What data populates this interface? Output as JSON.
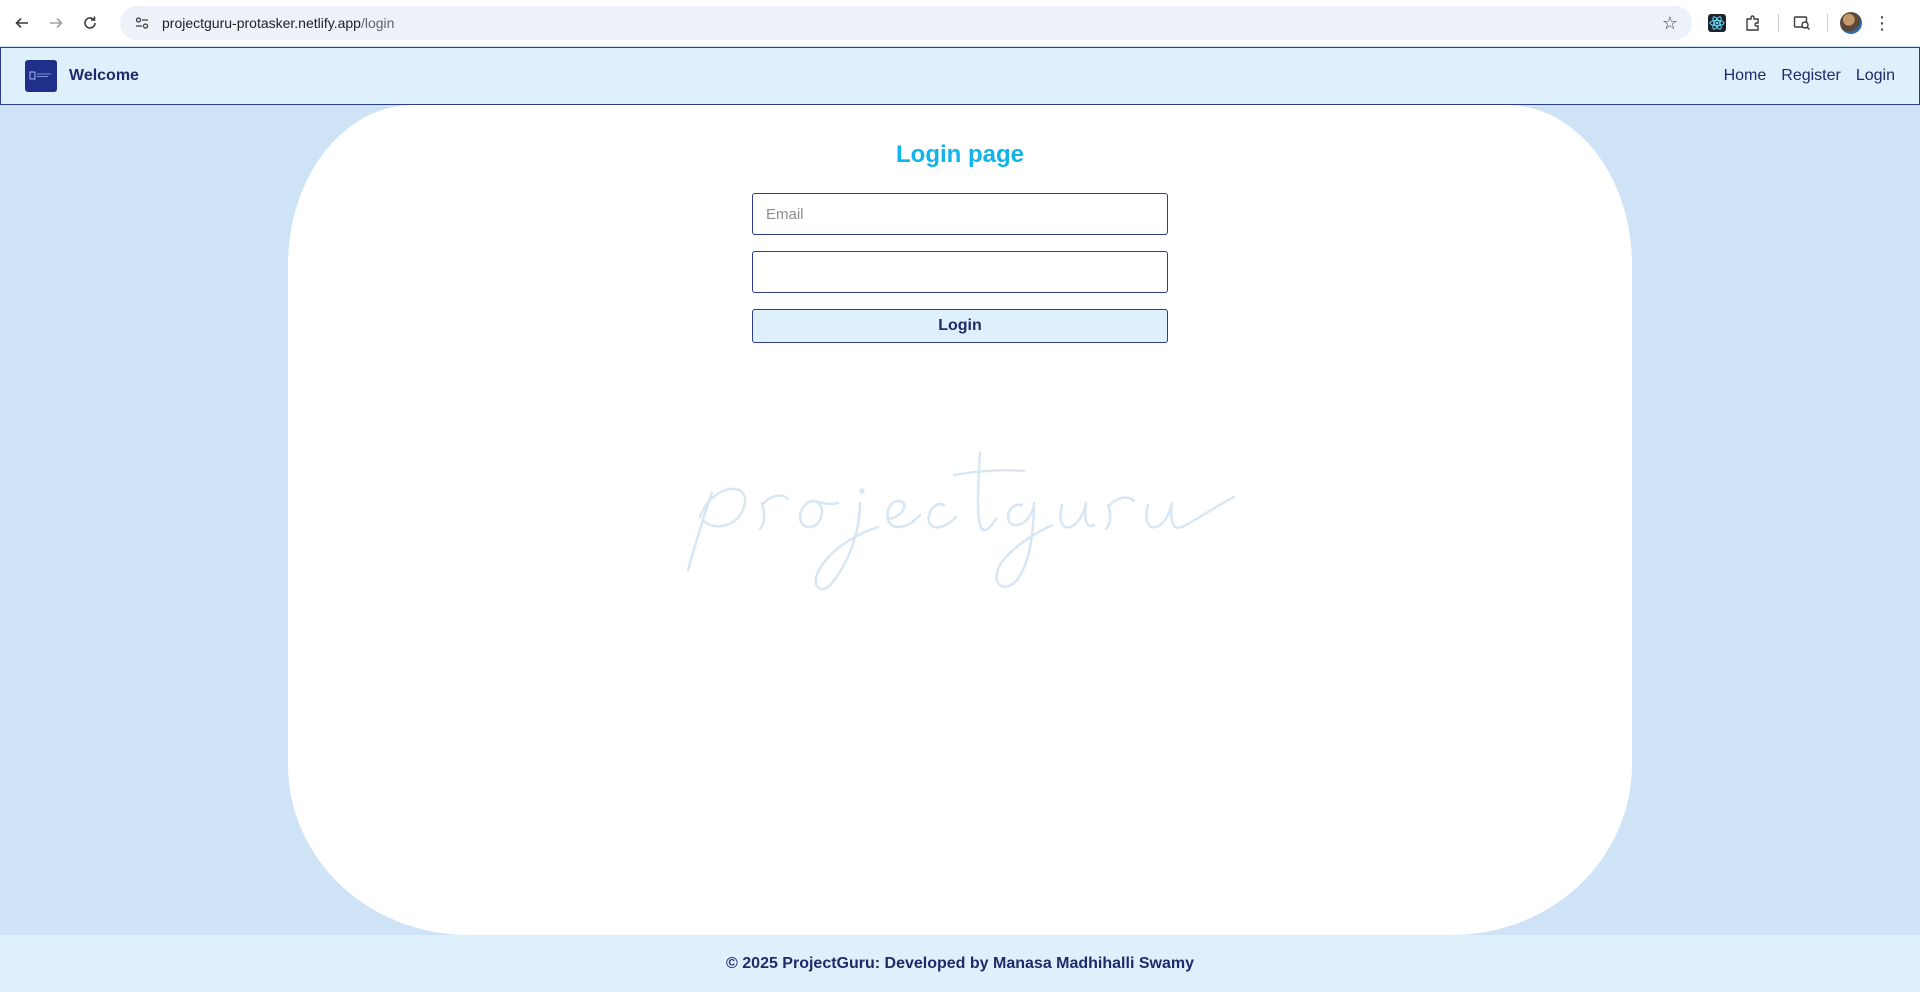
{
  "browser": {
    "url_host": "projectguru-protasker.netlify.app",
    "url_path": "/login"
  },
  "navbar": {
    "brand": "Welcome",
    "links": [
      "Home",
      "Register",
      "Login"
    ]
  },
  "login": {
    "title": "Login page",
    "email_placeholder": "Email",
    "email_value": "",
    "password_value": "",
    "button_label": "Login"
  },
  "watermark": {
    "text": "projectguru"
  },
  "footer": {
    "text": "© 2025 ProjectGuru: Developed by Manasa Madhihalli Swamy"
  },
  "colors": {
    "page_bg": "#cfe3f7",
    "navbar_bg": "#dff0fd",
    "accent_dark": "#1e2b6b",
    "title": "#10b3ea",
    "watermark": "#d6e6f4"
  }
}
